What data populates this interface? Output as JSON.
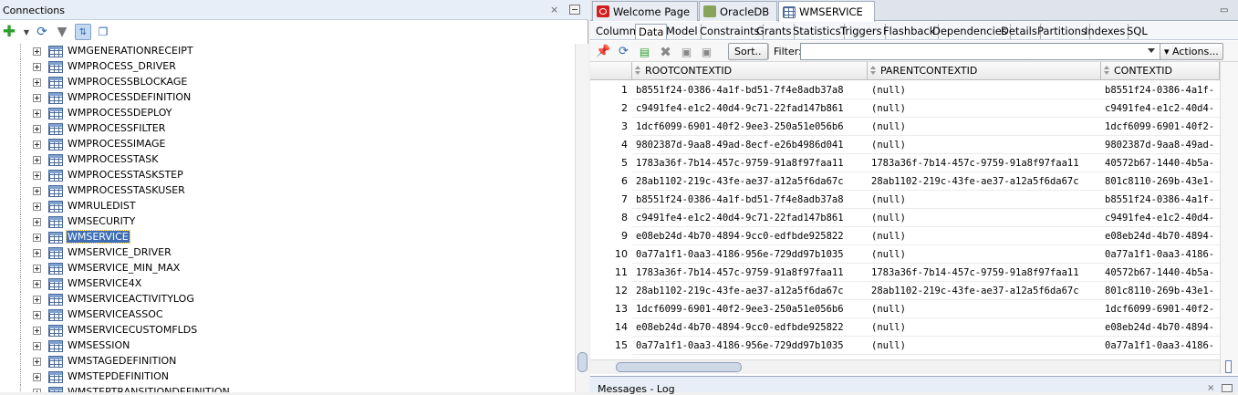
{
  "connections": {
    "title": "Connections",
    "close_glyph": "×",
    "toolbar_icons": [
      "add-connection-icon",
      "dropdown-arrow-icon",
      "refresh-icon",
      "filter-icon",
      "schema-browser-icon",
      "manage-icon"
    ],
    "tree_items": [
      "WMGENERATIONRECEIPT",
      "WMPROCESS_DRIVER",
      "WMPROCESSBLOCKAGE",
      "WMPROCESSDEFINITION",
      "WMPROCESSDEPLOY",
      "WMPROCESSFILTER",
      "WMPROCESSIMAGE",
      "WMPROCESSTASK",
      "WMPROCESSTASKSTEP",
      "WMPROCESSTASKUSER",
      "WMRULEDIST",
      "WMSECURITY",
      "WMSERVICE",
      "WMSERVICE_DRIVER",
      "WMSERVICE_MIN_MAX",
      "WMSERVICE4X",
      "WMSERVICEACTIVITYLOG",
      "WMSERVICEASSOC",
      "WMSERVICECUSTOMFLDS",
      "WMSESSION",
      "WMSTAGEDEFINITION",
      "WMSTEPDEFINITION",
      "WMSTEPTRANSITIONDEFINITION"
    ],
    "selected_item": "WMSERVICE"
  },
  "editor": {
    "tabs": [
      {
        "label": "Welcome Page",
        "icon": "oracle-icon"
      },
      {
        "label": "OracleDB",
        "icon": "sql-worksheet-icon"
      },
      {
        "label": "WMSERVICE",
        "icon": "table-icon",
        "active": true
      }
    ],
    "close_glyph": "×",
    "subtabs": [
      "Columns",
      "Data",
      "Model",
      "Constraints",
      "Grants",
      "Statistics",
      "Triggers",
      "Flashback",
      "Dependencies",
      "Details",
      "Partitions",
      "Indexes",
      "SQL"
    ],
    "active_subtab": "Data",
    "toolbar": {
      "sort_label": "Sort..",
      "filter_label": "Filter:",
      "filter_value": "",
      "actions_label": "Actions..."
    }
  },
  "grid": {
    "columns": [
      "ROOTCONTEXTID",
      "PARENTCONTEXTID",
      "CONTEXTID"
    ],
    "rows": [
      [
        "1",
        "b8551f24-0386-4a1f-bd51-7f4e8adb37a8",
        "(null)",
        "b8551f24-0386-4a1f-"
      ],
      [
        "2",
        "c9491fe4-e1c2-40d4-9c71-22fad147b861",
        "(null)",
        "c9491fe4-e1c2-40d4-"
      ],
      [
        "3",
        "1dcf6099-6901-40f2-9ee3-250a51e056b6",
        "(null)",
        "1dcf6099-6901-40f2-"
      ],
      [
        "4",
        "9802387d-9aa8-49ad-8ecf-e26b4986d041",
        "(null)",
        "9802387d-9aa8-49ad-"
      ],
      [
        "5",
        "1783a36f-7b14-457c-9759-91a8f97faa11",
        "1783a36f-7b14-457c-9759-91a8f97faa11",
        "40572b67-1440-4b5a-"
      ],
      [
        "6",
        "28ab1102-219c-43fe-ae37-a12a5f6da67c",
        "28ab1102-219c-43fe-ae37-a12a5f6da67c",
        "801c8110-269b-43e1-"
      ],
      [
        "7",
        "b8551f24-0386-4a1f-bd51-7f4e8adb37a8",
        "(null)",
        "b8551f24-0386-4a1f-"
      ],
      [
        "8",
        "c9491fe4-e1c2-40d4-9c71-22fad147b861",
        "(null)",
        "c9491fe4-e1c2-40d4-"
      ],
      [
        "9",
        "e08eb24d-4b70-4894-9cc0-edfbde925822",
        "(null)",
        "e08eb24d-4b70-4894-"
      ],
      [
        "10",
        "0a77a1f1-0aa3-4186-956e-729dd97b1035",
        "(null)",
        "0a77a1f1-0aa3-4186-"
      ],
      [
        "11",
        "1783a36f-7b14-457c-9759-91a8f97faa11",
        "1783a36f-7b14-457c-9759-91a8f97faa11",
        "40572b67-1440-4b5a-"
      ],
      [
        "12",
        "28ab1102-219c-43fe-ae37-a12a5f6da67c",
        "28ab1102-219c-43fe-ae37-a12a5f6da67c",
        "801c8110-269b-43e1-"
      ],
      [
        "13",
        "1dcf6099-6901-40f2-9ee3-250a51e056b6",
        "(null)",
        "1dcf6099-6901-40f2-"
      ],
      [
        "14",
        "e08eb24d-4b70-4894-9cc0-edfbde925822",
        "(null)",
        "e08eb24d-4b70-4894-"
      ],
      [
        "15",
        "0a77a1f1-0aa3-4186-956e-729dd97b1035",
        "(null)",
        "0a77a1f1-0aa3-4186-"
      ]
    ]
  },
  "messages": {
    "title": "Messages - Log",
    "close_glyph": "×"
  },
  "colors": {
    "selection": "#3d6eb5",
    "panel_header": "#e8eef7",
    "add_icon": "#2e9e2e"
  }
}
